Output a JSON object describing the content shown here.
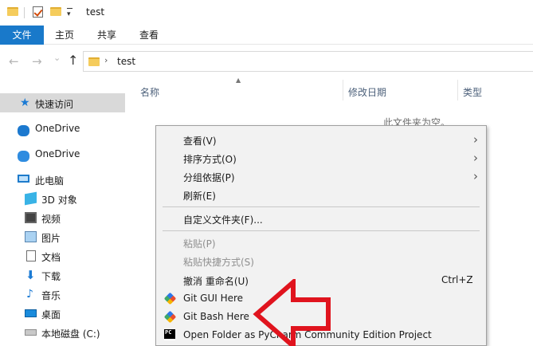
{
  "window": {
    "title": "test"
  },
  "ribbon": {
    "tabs": [
      "文件",
      "主页",
      "共享",
      "查看"
    ]
  },
  "address": {
    "path": "test",
    "nav_back": "←",
    "nav_forward": "→",
    "nav_up": "↑",
    "dropdown": "⌄",
    "chevron": "›"
  },
  "sidebar": {
    "items": [
      {
        "label": "快速访问",
        "icon": "star-icon"
      },
      {
        "label": "OneDrive",
        "icon": "cloud-icon"
      },
      {
        "label": "OneDrive",
        "icon": "cloud-icon"
      },
      {
        "label": "此电脑",
        "icon": "computer-icon"
      },
      {
        "label": "3D 对象",
        "icon": "3d-objects-icon"
      },
      {
        "label": "视频",
        "icon": "video-icon"
      },
      {
        "label": "图片",
        "icon": "picture-icon"
      },
      {
        "label": "文档",
        "icon": "document-icon"
      },
      {
        "label": "下载",
        "icon": "download-icon"
      },
      {
        "label": "音乐",
        "icon": "music-icon"
      },
      {
        "label": "桌面",
        "icon": "desktop-icon"
      },
      {
        "label": "本地磁盘 (C:)",
        "icon": "disk-icon"
      }
    ]
  },
  "columns": {
    "name": "名称",
    "modified": "修改日期",
    "type": "类型"
  },
  "empty_message": "此文件夹为空。",
  "context_menu": {
    "items": [
      {
        "label": "查看(V)",
        "submenu": "›"
      },
      {
        "label": "排序方式(O)",
        "submenu": "›"
      },
      {
        "label": "分组依据(P)",
        "submenu": "›"
      },
      {
        "label": "刷新(E)"
      },
      {
        "label": "自定义文件夹(F)..."
      },
      {
        "label": "粘贴(P)"
      },
      {
        "label": "粘贴快捷方式(S)"
      },
      {
        "label": "撤消 重命名(U)",
        "shortcut": "Ctrl+Z"
      },
      {
        "label": "Git GUI Here",
        "icon": "git-icon"
      },
      {
        "label": "Git Bash Here",
        "icon": "git-icon"
      },
      {
        "label": "Open Folder as PyCharm Community Edition Project",
        "icon": "pycharm-icon",
        "icon_text": "PC"
      }
    ]
  },
  "colors": {
    "accent": "#1979ca",
    "annotation": "#e0141e",
    "menu_bg": "#f2f2f2",
    "selected": "#d9d9d9"
  }
}
